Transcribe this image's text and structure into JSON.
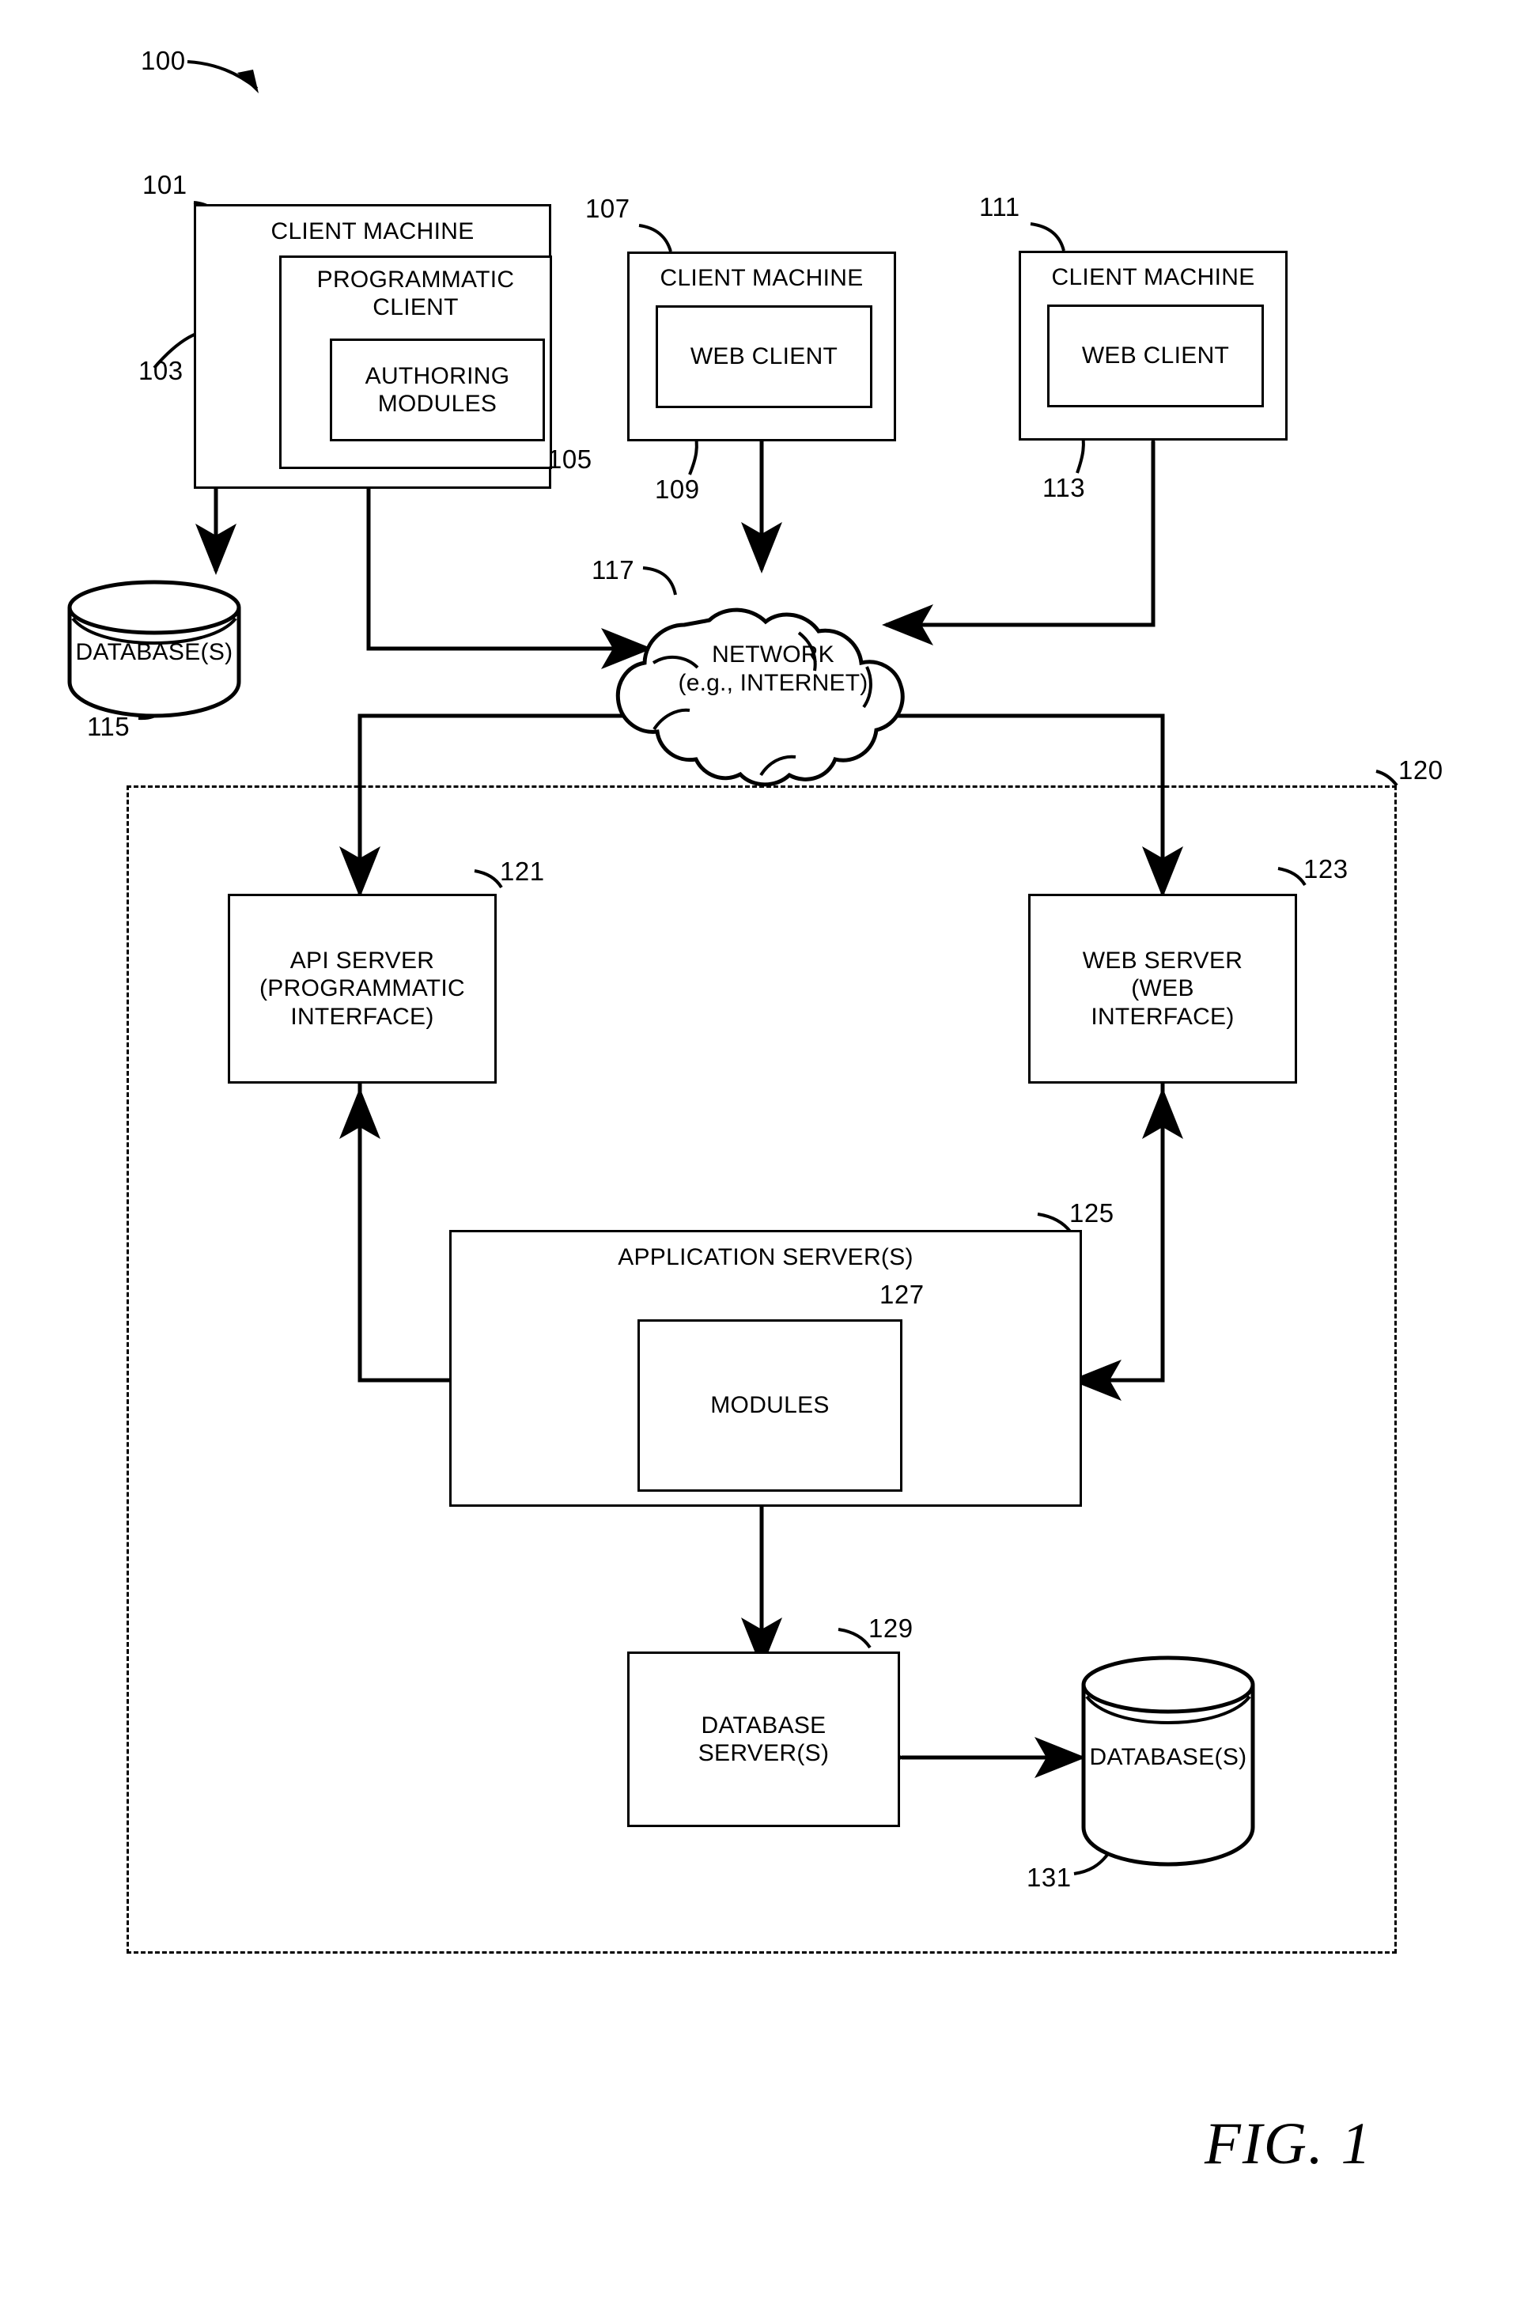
{
  "figure": {
    "caption": "FIG. 1",
    "system_ref": "100"
  },
  "nodes": {
    "client_machine_1": {
      "ref": "101",
      "title": "CLIENT MACHINE",
      "inner": {
        "ref": "103",
        "title": "PROGRAMMATIC\nCLIENT",
        "inner": {
          "ref": "105",
          "title": "AUTHORING\nMODULES"
        }
      }
    },
    "client_machine_2": {
      "ref": "107",
      "title": "CLIENT MACHINE",
      "inner": {
        "ref": "109",
        "title": "WEB CLIENT"
      }
    },
    "client_machine_3": {
      "ref": "111",
      "title": "CLIENT MACHINE",
      "inner": {
        "ref": "113",
        "title": "WEB CLIENT"
      }
    },
    "client_database": {
      "ref": "115",
      "title": "DATABASE(S)"
    },
    "network": {
      "ref": "117",
      "title": "NETWORK\n(e.g., INTERNET)"
    },
    "platform": {
      "ref": "120"
    },
    "api_server": {
      "ref": "121",
      "title": "API SERVER\n(PROGRAMMATIC\nINTERFACE)"
    },
    "web_server": {
      "ref": "123",
      "title": "WEB SERVER\n(WEB\nINTERFACE)"
    },
    "application_server": {
      "ref": "125",
      "title": "APPLICATION SERVER(S)",
      "inner": {
        "ref": "127",
        "title": "MODULES"
      }
    },
    "database_server": {
      "ref": "129",
      "title": "DATABASE\nSERVER(S)"
    },
    "server_database": {
      "ref": "131",
      "title": "DATABASE(S)"
    }
  },
  "colors": {
    "stroke": "#000000",
    "background": "#ffffff"
  }
}
